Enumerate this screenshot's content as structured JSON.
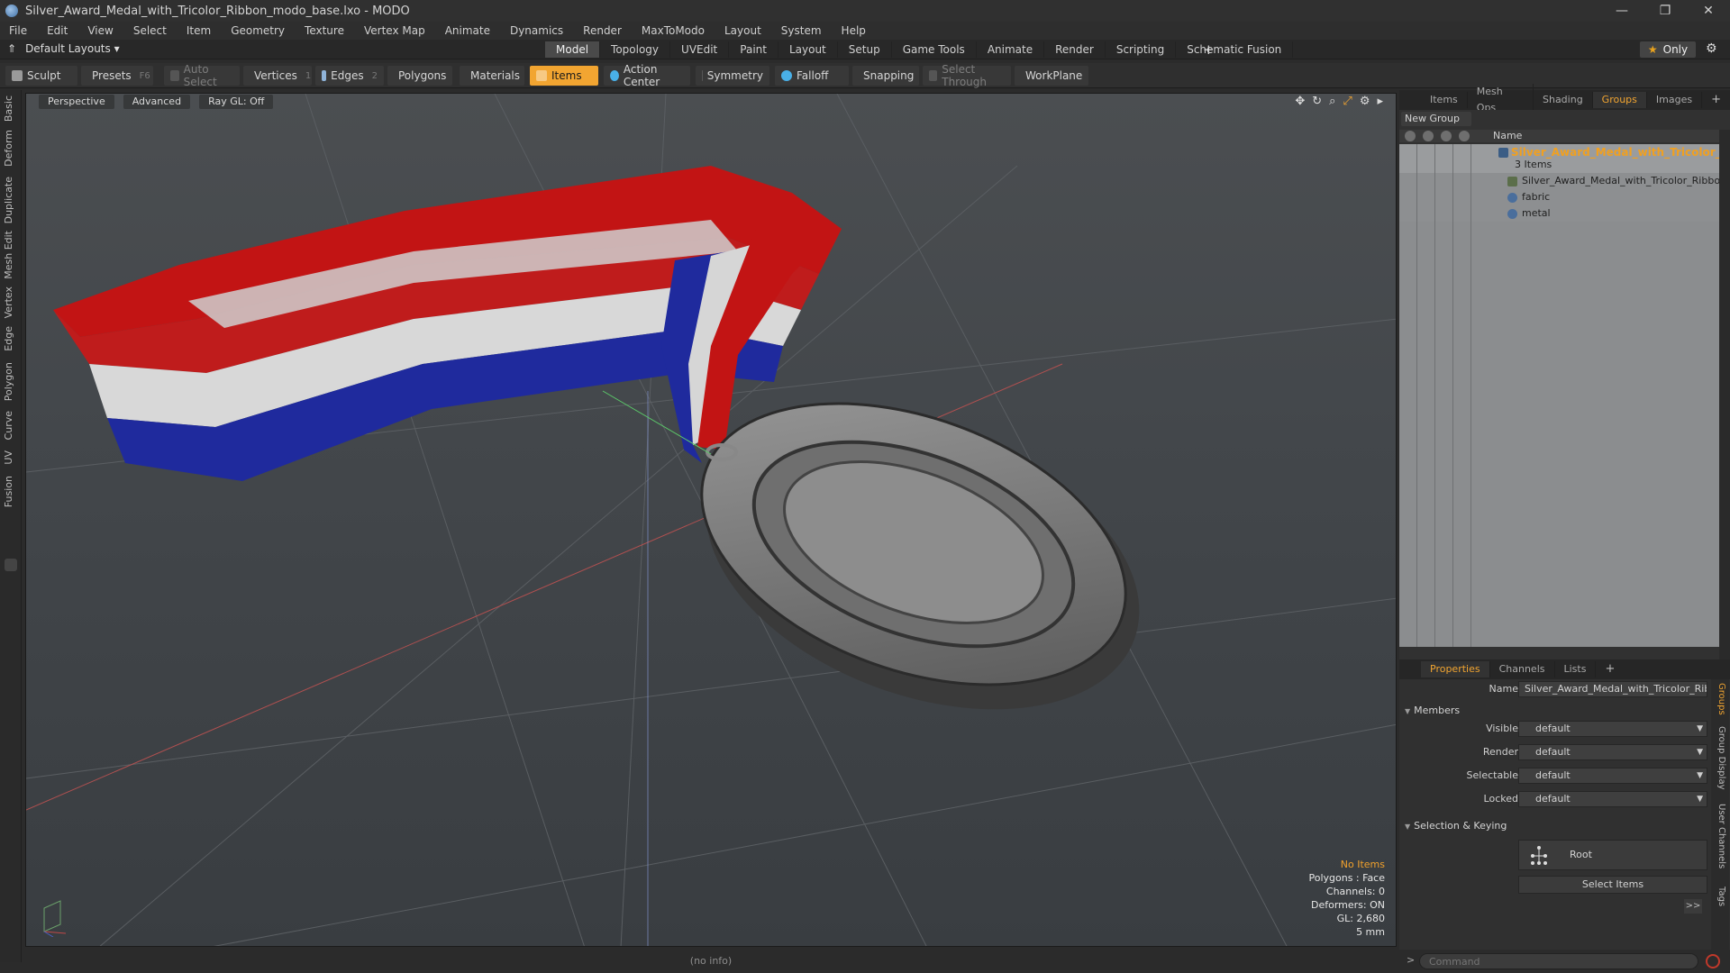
{
  "window": {
    "title": "Silver_Award_Medal_with_Tricolor_Ribbon_modo_base.lxo - MODO",
    "controls": [
      "—",
      "❐",
      "✕"
    ]
  },
  "menu": [
    "File",
    "Edit",
    "View",
    "Select",
    "Item",
    "Geometry",
    "Texture",
    "Vertex Map",
    "Animate",
    "Dynamics",
    "Render",
    "MaxToModo",
    "Layout",
    "System",
    "Help"
  ],
  "layoutbar": {
    "layouts_label": "Default Layouts ▾",
    "tabs": [
      "Model",
      "Topology",
      "UVEdit",
      "Paint",
      "Layout",
      "Setup",
      "Game Tools",
      "Animate",
      "Render",
      "Scripting",
      "Schematic Fusion"
    ],
    "active_tab": "Model",
    "plus": "+",
    "only_label": "Only"
  },
  "toolbar": {
    "sculpt": "Sculpt",
    "presets": "Presets",
    "presets_key": "F6",
    "auto_select": "Auto Select",
    "vertices": "Vertices",
    "vertices_count": "1",
    "edges": "Edges",
    "edges_count": "2",
    "polygons": "Polygons",
    "materials": "Materials",
    "items": "Items",
    "action_center": "Action Center",
    "symmetry": "Symmetry",
    "falloff": "Falloff",
    "snapping": "Snapping",
    "select_through": "Select Through",
    "workplane": "WorkPlane"
  },
  "left_tabs": [
    "Basic",
    "Deform",
    "Duplicate",
    "Mesh Edit",
    "Vertex",
    "Edge",
    "Polygon",
    "Curve",
    "UV",
    "Fusion"
  ],
  "viewport": {
    "view_mode": "Perspective",
    "shading": "Advanced",
    "raygl": "Ray GL: Off",
    "info": {
      "selection": "No Items",
      "polygons": "Polygons : Face",
      "channels": "Channels: 0",
      "deformers": "Deformers: ON",
      "gl": "GL: 2,680",
      "unit": "5 mm"
    },
    "colors": {
      "ribbon_red": "#c21414",
      "ribbon_white": "#d9d9d9",
      "ribbon_blue": "#1c2a9c",
      "medal": "#8a8a8a"
    }
  },
  "statusbar": {
    "text": "(no info)"
  },
  "right_panel": {
    "tabs": [
      "Items",
      "Mesh Ops",
      "Shading",
      "Groups",
      "Images",
      "+"
    ],
    "active_tab": "Groups",
    "new_group": "New Group",
    "column_name": "Name",
    "groups": [
      {
        "name": "Silver_Award_Medal_with_Tricolor_...",
        "sub": "3 Items"
      },
      {
        "name": "Silver_Award_Medal_with_Tricolor_Ribbon"
      },
      {
        "name": "fabric"
      },
      {
        "name": "metal"
      }
    ],
    "props_tabs": [
      "Properties",
      "Channels",
      "Lists",
      "+"
    ],
    "props_active": "Properties",
    "name_label": "Name",
    "name_value": "Silver_Award_Medal_with_Tricolor_Ribbon",
    "members_section": "Members",
    "visible_label": "Visible",
    "visible_value": "default",
    "render_label": "Render",
    "render_value": "default",
    "selectable_label": "Selectable",
    "selectable_value": "default",
    "locked_label": "Locked",
    "locked_value": "default",
    "selection_section": "Selection & Keying",
    "root_label": "Root",
    "select_items": "Select Items",
    "expand": ">>",
    "side_tabs": [
      "Groups",
      "Group Display",
      "User Channels",
      "Tags"
    ],
    "command_placeholder": "Command",
    "command_prompt": ">"
  }
}
